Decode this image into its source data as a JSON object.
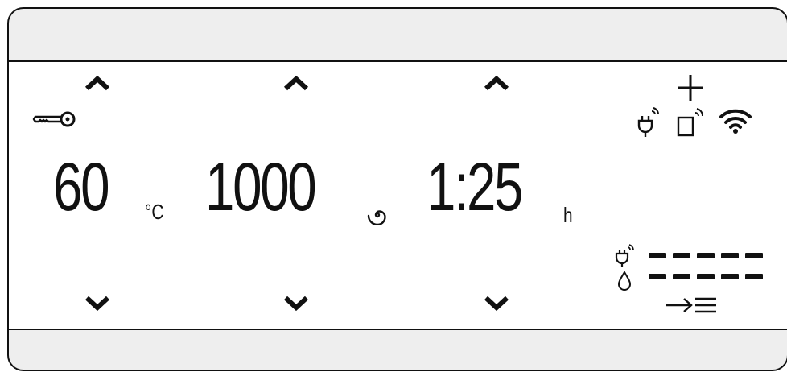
{
  "temperature": {
    "value": "60",
    "unit": "°C"
  },
  "spin": {
    "value": "1000"
  },
  "time": {
    "value": "1:25",
    "unit": "h"
  },
  "energy_level": {
    "segments_total": 5,
    "segments_on": 5
  },
  "water_level": {
    "segments_total": 5,
    "segments_on": 5
  },
  "icons": {
    "child_lock": "key-icon",
    "spin": "spiral-icon",
    "plus": "plus-icon",
    "smart_plug": "plug-icon",
    "remote": "phone-remote-icon",
    "wifi": "wifi-icon",
    "energy": "plug-icon",
    "water": "drop-icon",
    "option": "arrow-list-icon"
  }
}
